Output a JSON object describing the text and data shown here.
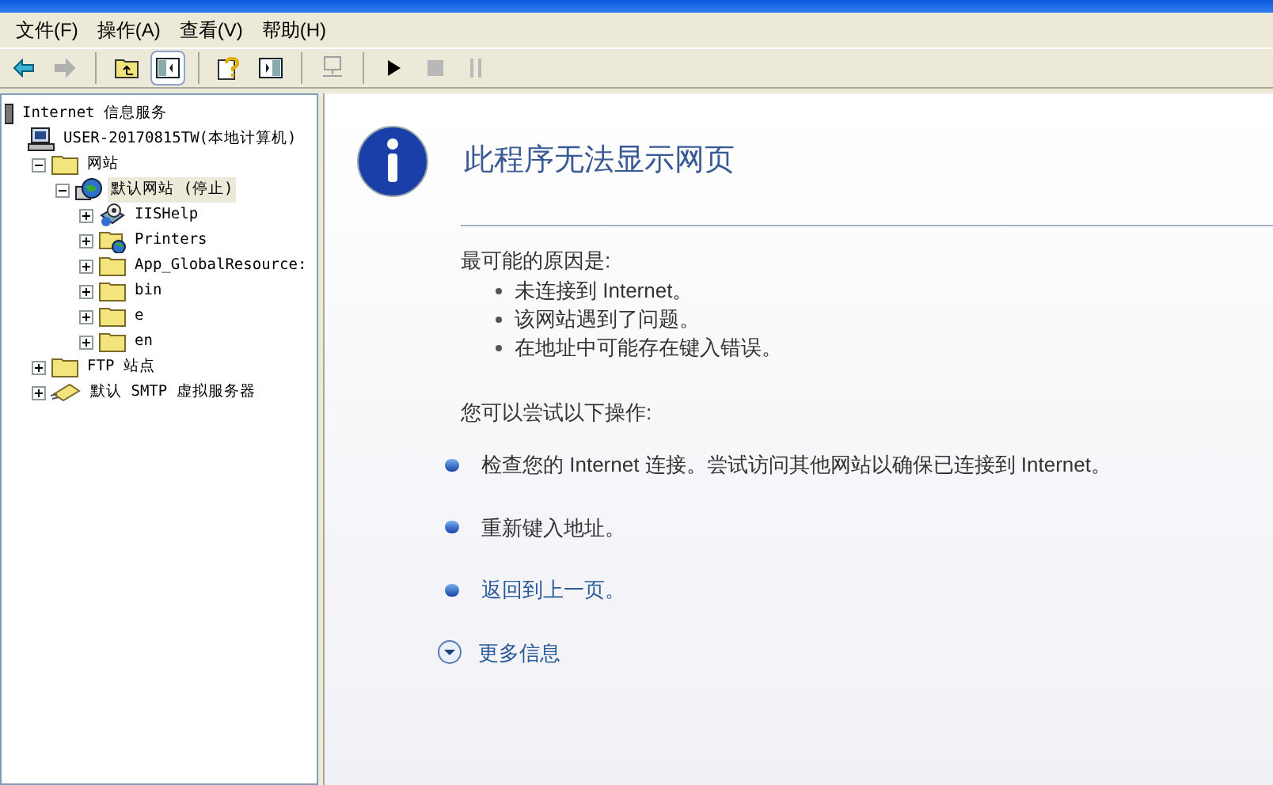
{
  "menu": [
    "文件(F)",
    "操作(A)",
    "查看(V)",
    "帮助(H)"
  ],
  "toolbar": [
    {
      "kind": "back",
      "disabled": false,
      "pressed": false
    },
    {
      "kind": "forward",
      "disabled": true,
      "pressed": false
    },
    {
      "kind": "sep"
    },
    {
      "kind": "up",
      "disabled": false,
      "pressed": false
    },
    {
      "kind": "tree",
      "disabled": false,
      "pressed": true
    },
    {
      "kind": "sep"
    },
    {
      "kind": "help",
      "disabled": false,
      "pressed": false
    },
    {
      "kind": "panel",
      "disabled": false,
      "pressed": false
    },
    {
      "kind": "sep"
    },
    {
      "kind": "computer",
      "disabled": true,
      "pressed": false
    },
    {
      "kind": "sep"
    },
    {
      "kind": "play",
      "disabled": false,
      "pressed": false
    },
    {
      "kind": "stop",
      "disabled": true,
      "pressed": false
    },
    {
      "kind": "pause",
      "disabled": true,
      "pressed": false
    }
  ],
  "tree": [
    {
      "label": "Internet 信息服务",
      "kind": "service",
      "selected": false,
      "children": [
        {
          "label": "USER-20170815TW(本地计算机)",
          "kind": "computer",
          "selected": false,
          "children": [
            {
              "label": "网站",
              "kind": "folder",
              "expanded": true,
              "selected": false,
              "children": [
                {
                  "label": "默认网站 (停止)",
                  "kind": "site",
                  "expanded": true,
                  "selected": true,
                  "children": [
                    {
                      "label": "IISHelp",
                      "kind": "app",
                      "expanded": false,
                      "selected": false
                    },
                    {
                      "label": "Printers",
                      "kind": "webfolder",
                      "expanded": false,
                      "selected": false
                    },
                    {
                      "label": "App_GlobalResource:",
                      "kind": "folder",
                      "expanded": false,
                      "selected": false
                    },
                    {
                      "label": "bin",
                      "kind": "folder",
                      "expanded": false,
                      "selected": false
                    },
                    {
                      "label": "e",
                      "kind": "folder",
                      "expanded": false,
                      "selected": false
                    },
                    {
                      "label": "en",
                      "kind": "folder",
                      "expanded": false,
                      "selected": false
                    }
                  ]
                }
              ]
            },
            {
              "label": "FTP 站点",
              "kind": "folder",
              "expanded": false,
              "selected": false
            },
            {
              "label": "默认 SMTP 虚拟服务器",
              "kind": "smtp",
              "expanded": false,
              "selected": false
            }
          ]
        }
      ]
    }
  ],
  "page": {
    "title": "此程序无法显示网页",
    "causes_heading": "最可能的原因是:",
    "causes": [
      "未连接到 Internet。",
      "该网站遇到了问题。",
      "在地址中可能存在键入错误。"
    ],
    "actions_heading": "您可以尝试以下操作:",
    "actions": [
      {
        "kind": "text",
        "label": "检查您的 Internet 连接。尝试访问其他网站以确保已连接到 Internet。"
      },
      {
        "kind": "text",
        "label": "重新键入地址。"
      },
      {
        "kind": "link",
        "label": "返回到上一页。"
      }
    ],
    "more_info": {
      "label": "更多信息",
      "expanded": false
    }
  }
}
